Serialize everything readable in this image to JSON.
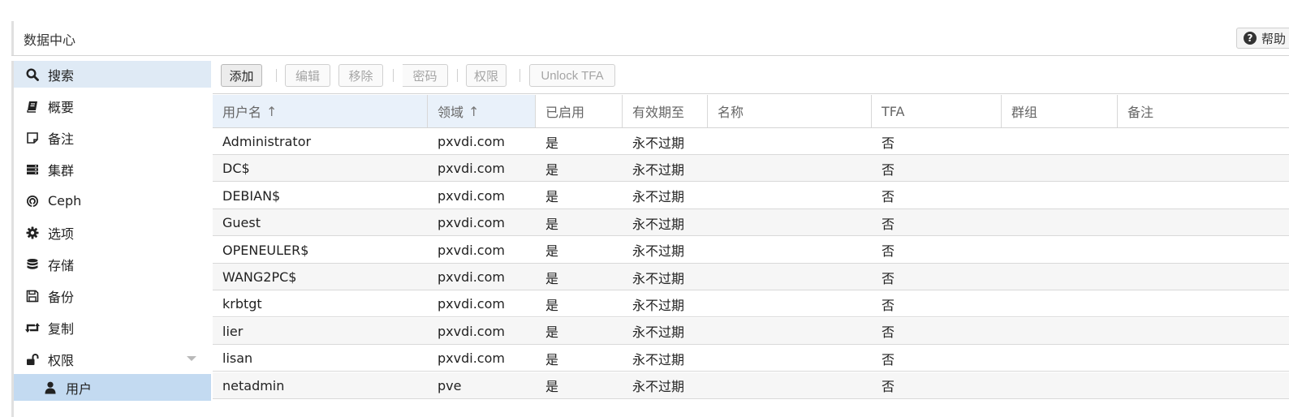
{
  "header": {
    "title": "数据中心",
    "help_label": "帮助"
  },
  "sidebar": {
    "items": [
      {
        "label": "搜索",
        "icon": "search-icon"
      },
      {
        "label": "概要",
        "icon": "book-icon"
      },
      {
        "label": "备注",
        "icon": "note-icon"
      },
      {
        "label": "集群",
        "icon": "server-icon"
      },
      {
        "label": "Ceph",
        "icon": "ceph-icon"
      },
      {
        "label": "选项",
        "icon": "gear-icon"
      },
      {
        "label": "存储",
        "icon": "database-icon"
      },
      {
        "label": "备份",
        "icon": "floppy-icon"
      },
      {
        "label": "复制",
        "icon": "retweet-icon"
      },
      {
        "label": "权限",
        "icon": "unlock-icon"
      },
      {
        "label": "用户",
        "icon": "user-icon"
      }
    ]
  },
  "toolbar": {
    "add": "添加",
    "edit": "编辑",
    "remove": "移除",
    "password": "密码",
    "permissions": "权限",
    "unlock_tfa": "Unlock TFA"
  },
  "table": {
    "columns": [
      "用户名",
      "领域",
      "已启用",
      "有效期至",
      "名称",
      "TFA",
      "群组",
      "备注"
    ],
    "sort_arrow": "↑",
    "rows": [
      {
        "user": "Administrator",
        "realm": "pxvdi.com",
        "enabled": "是",
        "expire": "永不过期",
        "name": "",
        "tfa": "否",
        "groups": "",
        "comment": ""
      },
      {
        "user": "DC$",
        "realm": "pxvdi.com",
        "enabled": "是",
        "expire": "永不过期",
        "name": "",
        "tfa": "否",
        "groups": "",
        "comment": ""
      },
      {
        "user": "DEBIAN$",
        "realm": "pxvdi.com",
        "enabled": "是",
        "expire": "永不过期",
        "name": "",
        "tfa": "否",
        "groups": "",
        "comment": ""
      },
      {
        "user": "Guest",
        "realm": "pxvdi.com",
        "enabled": "是",
        "expire": "永不过期",
        "name": "",
        "tfa": "否",
        "groups": "",
        "comment": ""
      },
      {
        "user": "OPENEULER$",
        "realm": "pxvdi.com",
        "enabled": "是",
        "expire": "永不过期",
        "name": "",
        "tfa": "否",
        "groups": "",
        "comment": ""
      },
      {
        "user": "WANG2PC$",
        "realm": "pxvdi.com",
        "enabled": "是",
        "expire": "永不过期",
        "name": "",
        "tfa": "否",
        "groups": "",
        "comment": ""
      },
      {
        "user": "krbtgt",
        "realm": "pxvdi.com",
        "enabled": "是",
        "expire": "永不过期",
        "name": "",
        "tfa": "否",
        "groups": "",
        "comment": ""
      },
      {
        "user": "lier",
        "realm": "pxvdi.com",
        "enabled": "是",
        "expire": "永不过期",
        "name": "",
        "tfa": "否",
        "groups": "",
        "comment": ""
      },
      {
        "user": "lisan",
        "realm": "pxvdi.com",
        "enabled": "是",
        "expire": "永不过期",
        "name": "",
        "tfa": "否",
        "groups": "",
        "comment": ""
      },
      {
        "user": "netadmin",
        "realm": "pve",
        "enabled": "是",
        "expire": "永不过期",
        "name": "",
        "tfa": "否",
        "groups": "",
        "comment": ""
      }
    ]
  }
}
